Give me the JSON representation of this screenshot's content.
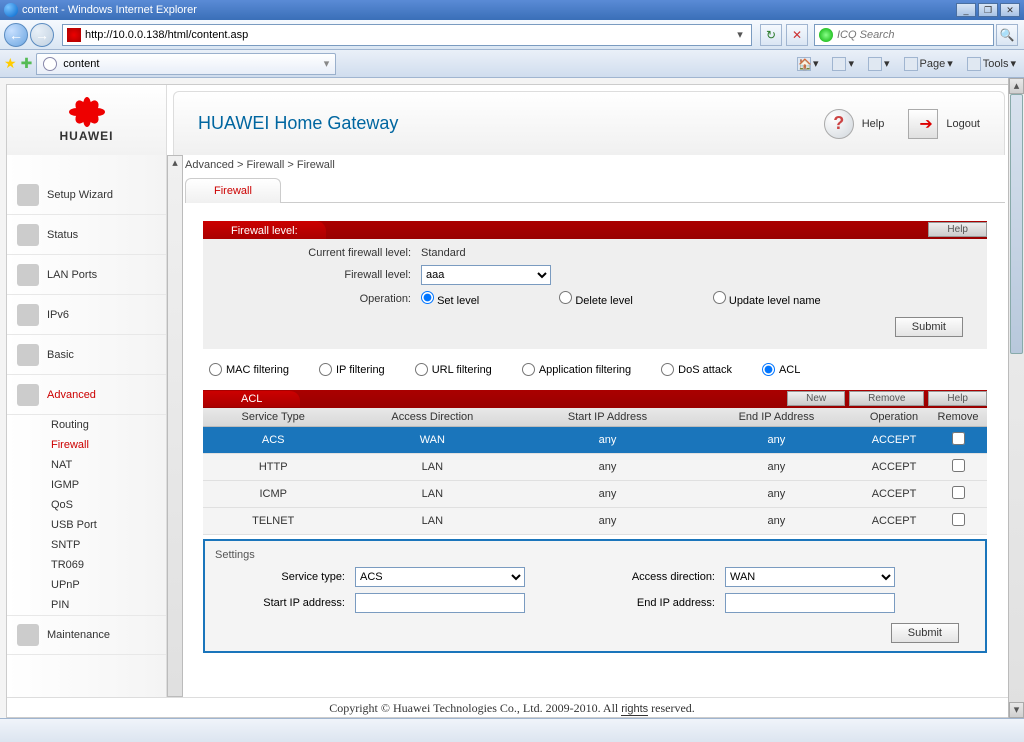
{
  "browser": {
    "window_title": "content - Windows Internet Explorer",
    "url": "http://10.0.0.138/html/content.asp",
    "tab_title": "content",
    "search_placeholder": "ICQ Search",
    "menu_page": "Page",
    "menu_tools": "Tools"
  },
  "brand": "HUAWEI",
  "header": {
    "title": "HUAWEI Home Gateway",
    "help": "Help",
    "logout": "Logout"
  },
  "sidebar": {
    "items": [
      {
        "label": "Setup Wizard"
      },
      {
        "label": "Status"
      },
      {
        "label": "LAN Ports"
      },
      {
        "label": "IPv6"
      },
      {
        "label": "Basic"
      },
      {
        "label": "Advanced"
      },
      {
        "label": "Maintenance"
      }
    ],
    "advanced_sub": [
      "Routing",
      "Firewall",
      "NAT",
      "IGMP",
      "QoS",
      "USB Port",
      "SNTP",
      "TR069",
      "UPnP",
      "PIN"
    ]
  },
  "breadcrumb": "Advanced > Firewall > Firewall",
  "subtab": "Firewall",
  "firewall_level": {
    "title": "Firewall level:",
    "help": "Help",
    "current_label": "Current firewall level:",
    "current_value": "Standard",
    "level_label": "Firewall level:",
    "level_value": "aaa",
    "operation_label": "Operation:",
    "ops": [
      "Set level",
      "Delete level",
      "Update level name"
    ],
    "submit": "Submit"
  },
  "filters": [
    "MAC filtering",
    "IP filtering",
    "URL filtering",
    "Application filtering",
    "DoS attack",
    "ACL"
  ],
  "acl": {
    "title": "ACL",
    "btn_new": "New",
    "btn_remove": "Remove",
    "btn_help": "Help",
    "cols": [
      "Service Type",
      "Access Direction",
      "Start IP Address",
      "End IP Address",
      "Operation",
      "Remove"
    ],
    "rows": [
      {
        "service": "ACS",
        "dir": "WAN",
        "start": "any",
        "end": "any",
        "op": "ACCEPT",
        "sel": true
      },
      {
        "service": "HTTP",
        "dir": "LAN",
        "start": "any",
        "end": "any",
        "op": "ACCEPT",
        "sel": false
      },
      {
        "service": "ICMP",
        "dir": "LAN",
        "start": "any",
        "end": "any",
        "op": "ACCEPT",
        "sel": false
      },
      {
        "service": "TELNET",
        "dir": "LAN",
        "start": "any",
        "end": "any",
        "op": "ACCEPT",
        "sel": false
      }
    ]
  },
  "settings": {
    "title": "Settings",
    "service_type_label": "Service type:",
    "service_type_value": "ACS",
    "access_dir_label": "Access direction:",
    "access_dir_value": "WAN",
    "start_ip_label": "Start IP address:",
    "start_ip_value": "",
    "end_ip_label": "End IP address:",
    "end_ip_value": "",
    "submit": "Submit"
  },
  "footer": "Copyright © Huawei Technologies Co., Ltd. 2009-2010. All rights reserved.",
  "footer_link_word": "rights"
}
